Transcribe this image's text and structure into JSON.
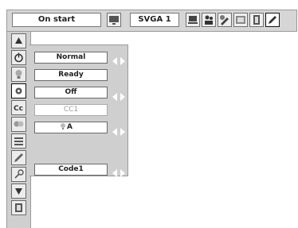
{
  "toolbar": {
    "title": "On start",
    "resolution": "SVGA 1",
    "icons": [
      "monitor-icon",
      "laptop-icon",
      "people-icon",
      "tools-icon",
      "screen-icon",
      "exit-door-icon",
      "pencil-icon"
    ]
  },
  "sidebar": {
    "items": [
      {
        "icon": "up-arrow-icon"
      },
      {
        "icon": "power-icon"
      },
      {
        "icon": "lamp-icon"
      },
      {
        "icon": "settings-gear-icon",
        "active": true
      },
      {
        "icon": "closed-caption-icon"
      },
      {
        "icon": "lamp-bulbs-icon"
      },
      {
        "icon": "filter-icon"
      },
      {
        "icon": "pencil-icon"
      },
      {
        "icon": "key-icon"
      },
      {
        "icon": "down-arrow-icon"
      },
      {
        "icon": "page-icon"
      }
    ]
  },
  "menu": {
    "rows": [
      {
        "value": "Normal",
        "arrows": true
      },
      {
        "value": "Ready",
        "arrows": false
      },
      {
        "value": "Off",
        "arrows": true
      },
      {
        "value": "CC1",
        "arrows": false,
        "dim": true
      },
      {
        "value": "A",
        "arrows": true
      },
      {
        "value": "Code1",
        "arrows": true
      }
    ]
  },
  "colors": {
    "panel": "#cfcfcf",
    "arrow": "#ffffff"
  }
}
